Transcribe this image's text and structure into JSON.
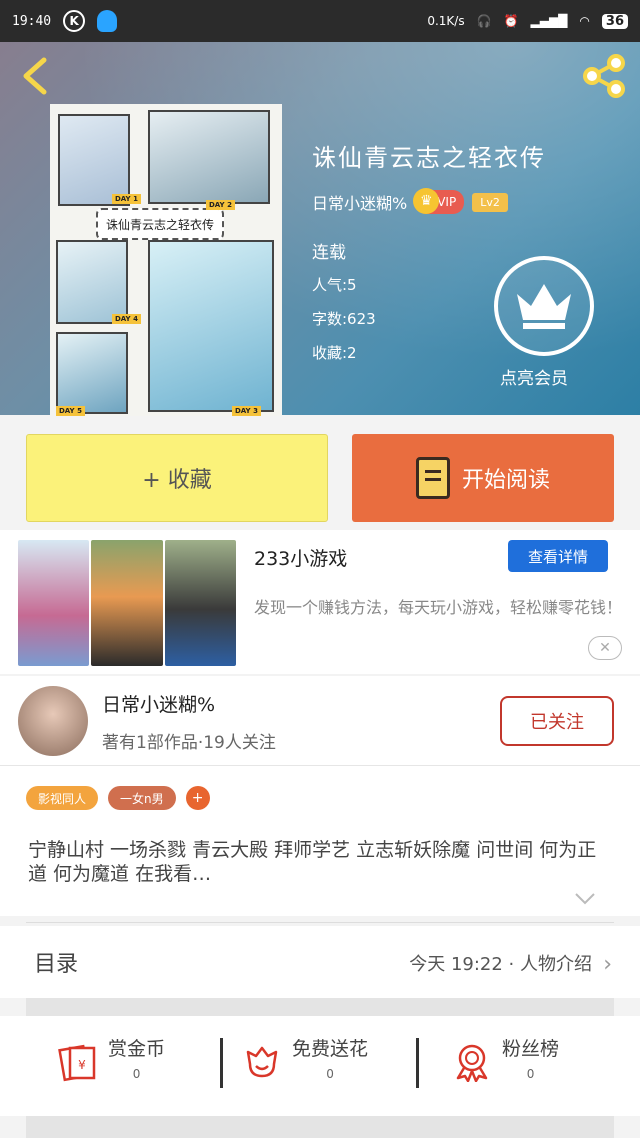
{
  "status_bar": {
    "time": "19:40",
    "k_icon": "K",
    "net_speed": "0.1K/s",
    "battery": "36"
  },
  "book": {
    "title": "诛仙青云志之轻衣传",
    "author": "日常小迷糊%",
    "vip_label": "VIP",
    "level": "Lv2",
    "status": "连载",
    "popularity": "人气:5",
    "word_count": "字数:623",
    "favorites": "收藏:2",
    "member_label": "点亮会员",
    "cover_caption": "诛仙青云志之轻衣传",
    "cover_days": [
      "DAY 1",
      "DAY 2",
      "DAY 3",
      "DAY 4",
      "DAY 5"
    ]
  },
  "actions": {
    "collect_label": "+ 收藏",
    "read_label": "开始阅读"
  },
  "ad": {
    "title": "233小游戏",
    "detail_button": "查看详情",
    "description": "发现一个赚钱方法，每天玩小游戏，轻松赚零花钱！",
    "close_symbol": "✕"
  },
  "author_card": {
    "name": "日常小迷糊%",
    "subtitle": "著有1部作品·19人关注",
    "follow_label": "已关注"
  },
  "tags": [
    "影视同人",
    "一女n男",
    "+"
  ],
  "intro": "宁静山村  一场杀戮  青云大殿  拜师学艺  立志斩妖除魔  问世间  何为正道  何为魔道  在我看…",
  "toc": {
    "label": "目录",
    "latest": "今天 19:22 · 人物介绍",
    "arrow": "›"
  },
  "bottom_actions": [
    {
      "label": "赏金币",
      "count": "0"
    },
    {
      "label": "免费送花",
      "count": "0"
    },
    {
      "label": "粉丝榜",
      "count": "0"
    }
  ],
  "colors": {
    "collect_bg": "#fbf27a",
    "read_bg": "#e96d3f",
    "follow": "#c2372c",
    "ad_button": "#1f6fdb"
  }
}
